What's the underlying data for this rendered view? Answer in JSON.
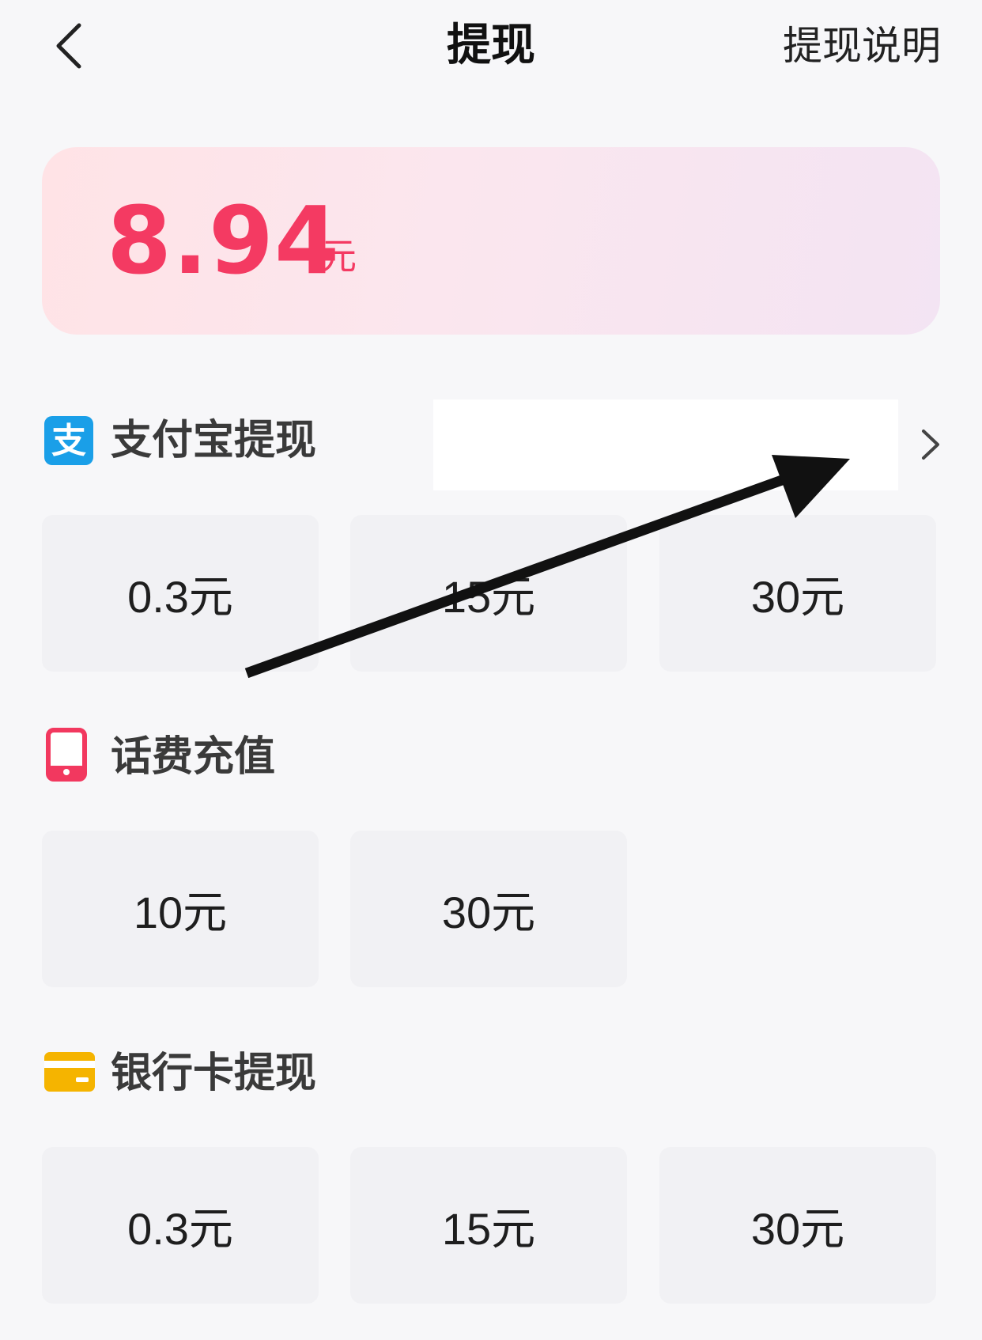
{
  "header": {
    "title": "提现",
    "help_label": "提现说明"
  },
  "balance": {
    "amount": "8.94",
    "unit": "元"
  },
  "sections": {
    "alipay": {
      "title": "支付宝提现",
      "icon": "alipay-icon",
      "options": [
        "0.3元",
        "15元",
        "30元"
      ]
    },
    "phone": {
      "title": "话费充值",
      "icon": "phone-icon",
      "options": [
        "10元",
        "30元"
      ]
    },
    "bank": {
      "title": "银行卡提现",
      "icon": "bank-card-icon",
      "options": [
        "0.3元",
        "15元",
        "30元"
      ]
    }
  },
  "colors": {
    "accent": "#f43a62",
    "alipay_blue": "#1a9fe8",
    "phone_red": "#f2385f",
    "card_yellow": "#f5b400",
    "tile_bg": "#f1f1f4",
    "page_bg": "#f7f7f9"
  }
}
